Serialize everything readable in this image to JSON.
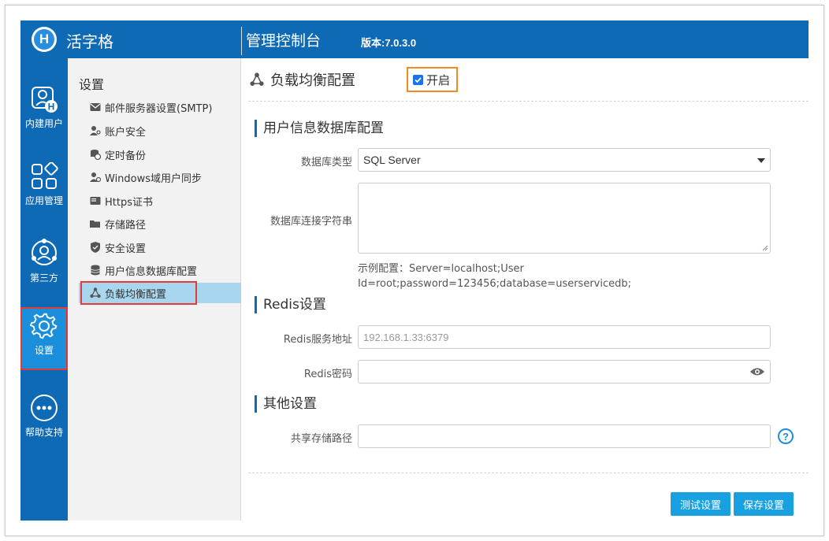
{
  "header": {
    "logo_letter": "H",
    "brand": "活字格",
    "console_title": "管理控制台",
    "version": "版本:7.0.3.0"
  },
  "leftnav": {
    "items": [
      {
        "label": "内建用户",
        "icon": "user-h-icon"
      },
      {
        "label": "应用管理",
        "icon": "apps-grid-icon"
      },
      {
        "label": "第三方",
        "icon": "third-party-icon"
      },
      {
        "label": "设置",
        "icon": "gear-icon",
        "active": true
      },
      {
        "label": "帮助支持",
        "icon": "more-icon"
      }
    ]
  },
  "sidebar": {
    "title": "设置",
    "items": [
      {
        "label": "邮件服务器设置(SMTP)",
        "icon": "envelope-icon"
      },
      {
        "label": "账户安全",
        "icon": "user-key-icon"
      },
      {
        "label": "定时备份",
        "icon": "backup-icon"
      },
      {
        "label": "Windows域用户同步",
        "icon": "user-sync-icon"
      },
      {
        "label": "Https证书",
        "icon": "certificate-icon"
      },
      {
        "label": "存储路径",
        "icon": "folder-icon"
      },
      {
        "label": "安全设置",
        "icon": "shield-icon"
      },
      {
        "label": "用户信息数据库配置",
        "icon": "database-icon"
      },
      {
        "label": "负载均衡配置",
        "icon": "load-balance-icon",
        "active": true
      }
    ]
  },
  "main": {
    "title": "负载均衡配置",
    "enable_label": "开启",
    "enable_checked": true,
    "sections": {
      "db": "用户信息数据库配置",
      "redis": "Redis设置",
      "other": "其他设置"
    },
    "fields": {
      "db_type_label": "数据库类型",
      "db_type_value": "SQL Server",
      "conn_label": "数据库连接字符串",
      "conn_value": "",
      "conn_hint": "示例配置：Server=localhost;User Id=root;password=123456;database=userservicedb;",
      "redis_addr_label": "Redis服务地址",
      "redis_addr_placeholder": "192.168.1.33:6379",
      "redis_pwd_label": "Redis密码",
      "shared_path_label": "共享存储路径"
    },
    "buttons": {
      "test": "测试设置",
      "save": "保存设置"
    }
  },
  "colors": {
    "brand_blue": "#0f6ab6",
    "active_nav": "#1b8fdb",
    "sidebar_active": "#a9d6ef",
    "button": "#18a0e0",
    "highlight_red": "#e53935",
    "highlight_orange": "#f08a24"
  }
}
